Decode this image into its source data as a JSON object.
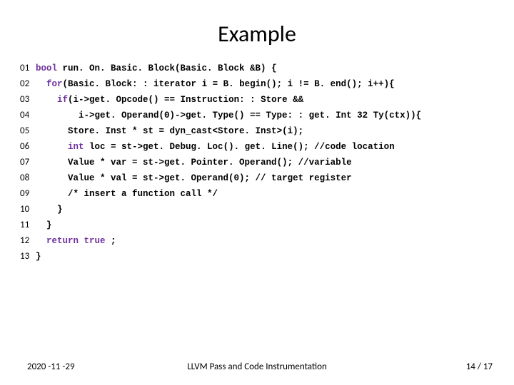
{
  "title": "Example",
  "lines": [
    {
      "n": "01",
      "i": 0,
      "t": [
        {
          "k": true,
          "s": "bool"
        },
        {
          "k": false,
          "s": " run. On. Basic. Block(Basic. Block &B) {"
        }
      ]
    },
    {
      "n": "02",
      "i": 1,
      "t": [
        {
          "k": true,
          "s": "for"
        },
        {
          "k": false,
          "s": "(Basic. Block: : iterator i = B. begin(); i != B. end(); i++){"
        }
      ]
    },
    {
      "n": "03",
      "i": 2,
      "t": [
        {
          "k": true,
          "s": "if"
        },
        {
          "k": false,
          "s": "(i->get. Opcode() == Instruction: : Store &&"
        }
      ]
    },
    {
      "n": "04",
      "i": 4,
      "t": [
        {
          "k": false,
          "s": "i->get. Operand(0)->get. Type() == Type: : get. Int 32 Ty(ctx)){"
        }
      ]
    },
    {
      "n": "05",
      "i": 3,
      "t": [
        {
          "k": false,
          "s": "Store. Inst * st = dyn_cast<Store. Inst>(i);"
        }
      ]
    },
    {
      "n": "06",
      "i": 3,
      "t": [
        {
          "k": true,
          "s": "int"
        },
        {
          "k": false,
          "s": " loc = st->get. Debug. Loc(). get. Line(); //code location"
        }
      ]
    },
    {
      "n": "07",
      "i": 3,
      "t": [
        {
          "k": false,
          "s": "Value * var = st->get. Pointer. Operand(); //variable"
        }
      ]
    },
    {
      "n": "08",
      "i": 3,
      "t": [
        {
          "k": false,
          "s": "Value * val = st->get. Operand(0); // target register"
        }
      ]
    },
    {
      "n": "09",
      "i": 3,
      "t": [
        {
          "k": false,
          "s": "/* insert a function call */"
        }
      ]
    },
    {
      "n": "10",
      "i": 2,
      "t": [
        {
          "k": false,
          "s": "}"
        }
      ]
    },
    {
      "n": "11",
      "i": 1,
      "t": [
        {
          "k": false,
          "s": "}"
        }
      ]
    },
    {
      "n": "12",
      "i": 1,
      "t": [
        {
          "k": true,
          "s": "return true"
        },
        {
          "k": false,
          "s": " ;"
        }
      ]
    },
    {
      "n": "13",
      "i": 0,
      "t": [
        {
          "k": false,
          "s": "}"
        }
      ]
    }
  ],
  "footer": {
    "date": "2020 -11 -29",
    "center": "LLVM Pass and Code Instrumentation",
    "page_num": "14",
    "page_sep": " / ",
    "page_total": "17"
  }
}
